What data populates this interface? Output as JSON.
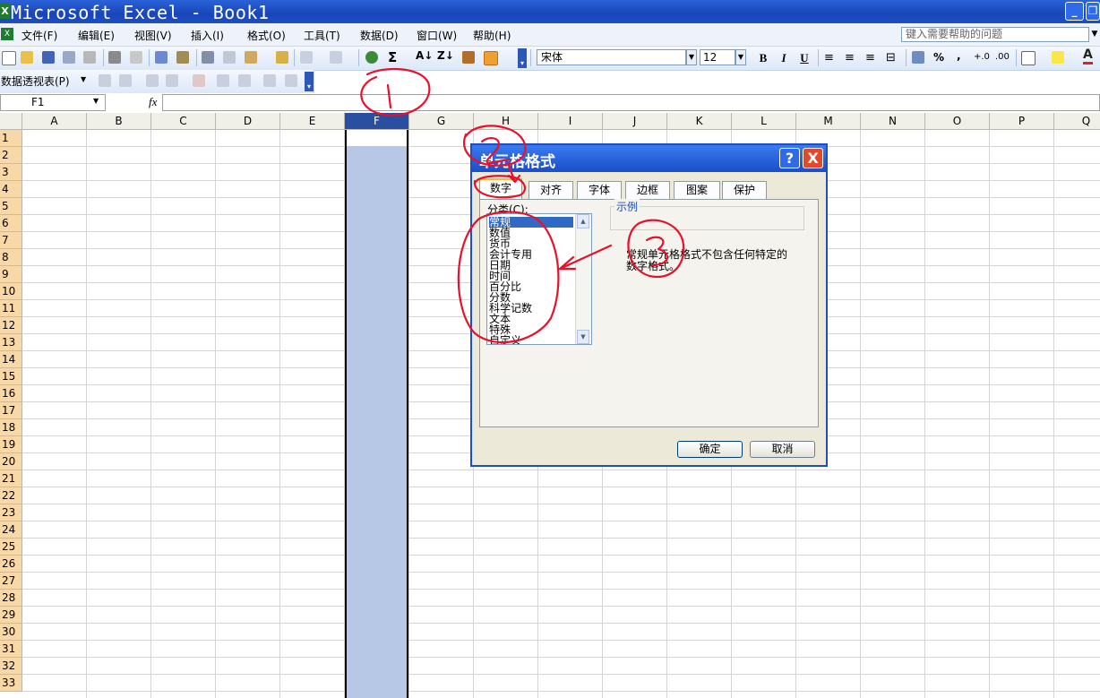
{
  "window": {
    "title": "Microsoft Excel - Book1",
    "app_icon_letter": "X",
    "controls": [
      "minimize-icon",
      "restore-icon"
    ]
  },
  "menubar": {
    "items": [
      "文件(F)",
      "编辑(E)",
      "视图(V)",
      "插入(I)",
      "格式(O)",
      "工具(T)",
      "数据(D)",
      "窗口(W)",
      "帮助(H)"
    ],
    "help_placeholder": "键入需要帮助的问题"
  },
  "toolbar": {
    "font_name": "宋体",
    "font_size": "12",
    "bold": "B",
    "italic": "I",
    "underline": "U",
    "percent": "%",
    "comma": ",",
    "pivot_table_label": "数据透视表(P)"
  },
  "formula_bar": {
    "name_box": "F1",
    "fx": "fx",
    "value": ""
  },
  "sheet": {
    "columns": [
      "A",
      "B",
      "C",
      "D",
      "E",
      "F",
      "G",
      "H",
      "I",
      "J",
      "K",
      "L",
      "M",
      "N",
      "O",
      "P",
      "Q"
    ],
    "selected_column": "F",
    "rows": [
      "1",
      "2",
      "3",
      "4",
      "5",
      "6",
      "7",
      "8",
      "9",
      "10",
      "11",
      "12",
      "13",
      "14",
      "15",
      "16",
      "17",
      "18",
      "19",
      "20",
      "21",
      "22",
      "23",
      "24",
      "25",
      "26",
      "27",
      "28",
      "29",
      "30",
      "31",
      "32",
      "33"
    ]
  },
  "dialog": {
    "title": "单元格格式",
    "help_btn": "?",
    "close_btn": "X",
    "tabs": [
      "数字",
      "对齐",
      "字体",
      "边框",
      "图案",
      "保护"
    ],
    "active_tab": "数字",
    "category_label": "分类(C):",
    "categories": [
      "常规",
      "数值",
      "货币",
      "会计专用",
      "日期",
      "时间",
      "百分比",
      "分数",
      "科学记数",
      "文本",
      "特殊",
      "自定义"
    ],
    "selected_category": "常规",
    "sample_label": "示例",
    "description": "常规单元格格式不包含任何特定的数字格式。",
    "ok_label": "确定",
    "cancel_label": "取消"
  },
  "annotation_color": "#e8102a"
}
